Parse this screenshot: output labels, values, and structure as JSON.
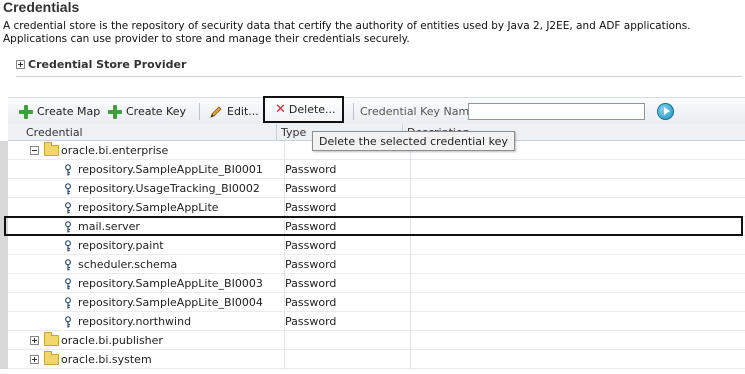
{
  "page": {
    "title": "Credentials",
    "description": "A credential store is the repository of security data that certify the authority of entities used by Java 2, J2EE, and ADF applications. Applications can use provider to store and manage their credentials securely."
  },
  "section": {
    "label": "Credential Store Provider"
  },
  "toolbar": {
    "create_map": "Create Map",
    "create_key": "Create Key",
    "edit": "Edit...",
    "delete": "Delete...",
    "credential_key_name_label": "Credential Key Name",
    "credential_key_name_value": ""
  },
  "tooltip": {
    "text": "Delete the selected credential key"
  },
  "table": {
    "columns": [
      "Credential",
      "Type",
      "Description"
    ],
    "rows": [
      {
        "name": "oracle.bi.enterprise",
        "type": ""
      },
      {
        "name": "repository.SampleAppLite_BI0001",
        "type": "Password"
      },
      {
        "name": "repository.UsageTracking_BI0002",
        "type": "Password"
      },
      {
        "name": "repository.SampleAppLite",
        "type": "Password"
      },
      {
        "name": "mail.server",
        "type": "Password"
      },
      {
        "name": "repository.paint",
        "type": "Password"
      },
      {
        "name": "scheduler.schema",
        "type": "Password"
      },
      {
        "name": "repository.SampleAppLite_BI0003",
        "type": "Password"
      },
      {
        "name": "repository.SampleAppLite_BI0004",
        "type": "Password"
      },
      {
        "name": "repository.northwind",
        "type": "Password"
      },
      {
        "name": "oracle.bi.publisher",
        "type": ""
      },
      {
        "name": "oracle.bi.system",
        "type": ""
      }
    ]
  },
  "colors": {
    "selection_border": "#111111",
    "add_icon": "#3aa23a",
    "delete_icon": "#d32f2f"
  },
  "icons": [
    "expand-icon",
    "collapse-icon",
    "folder-icon",
    "key-icon",
    "add-icon",
    "pencil-icon",
    "delete-icon",
    "go-icon"
  ]
}
